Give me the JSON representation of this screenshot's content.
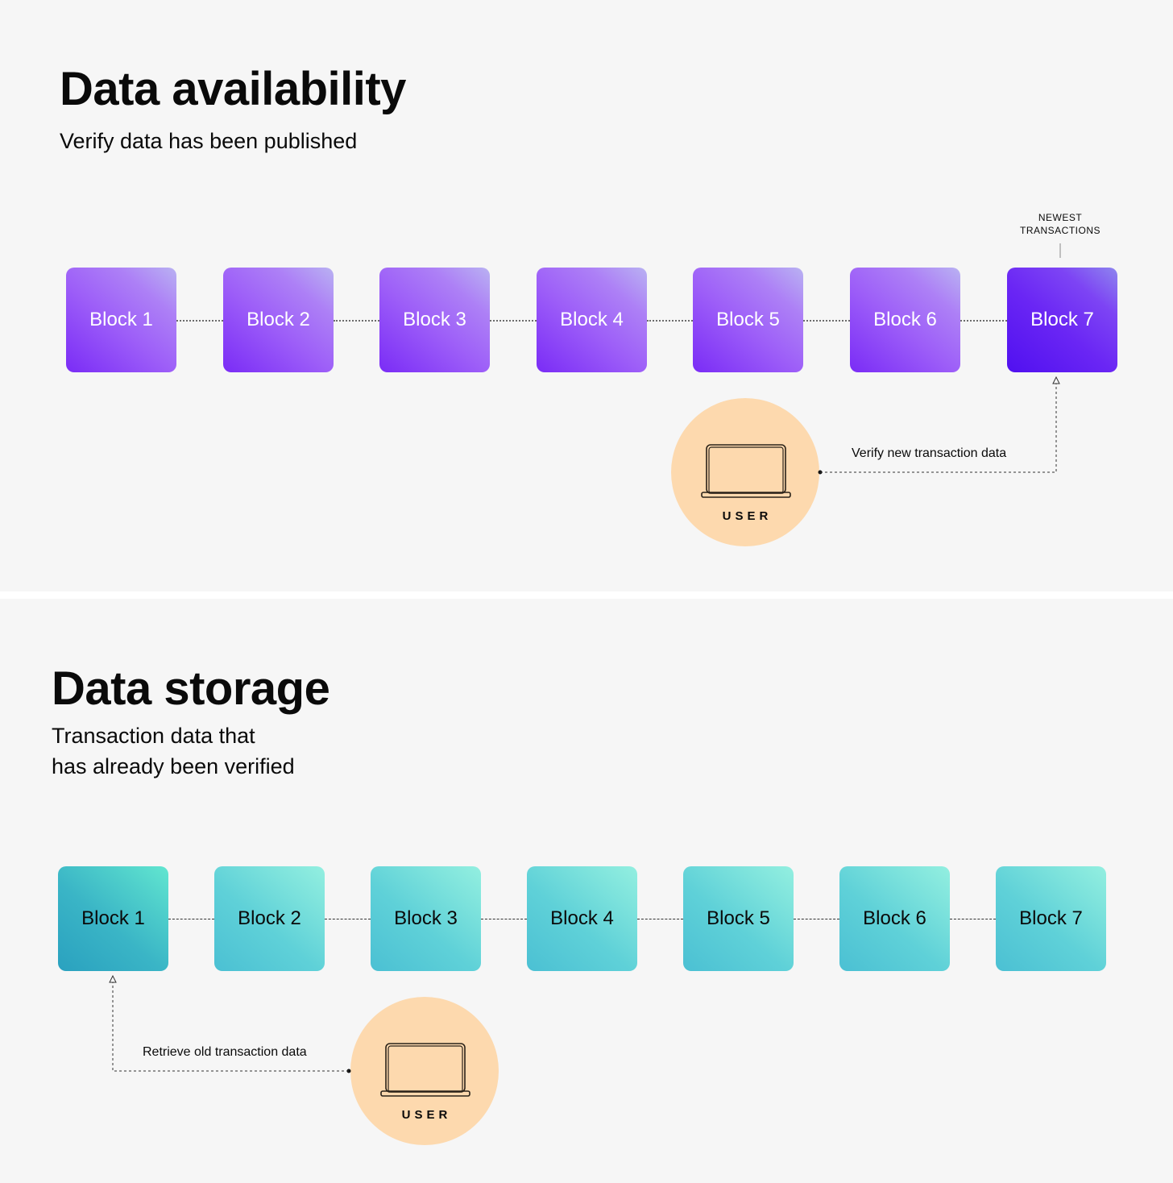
{
  "availability": {
    "title": "Data availability",
    "subtitle": "Verify data has been published",
    "blocks": [
      "Block 1",
      "Block 2",
      "Block 3",
      "Block 4",
      "Block 5",
      "Block 6",
      "Block 7"
    ],
    "newest_label": "NEWEST\nTRANSACTIONS",
    "user_label": "USER",
    "edge_label": "Verify new transaction data",
    "colors": {
      "block": "#9d5ef8",
      "newest_block": "#6a26f4",
      "user": "#fdd9ae"
    }
  },
  "storage": {
    "title": "Data storage",
    "subtitle": "Transaction data that\nhas already been verified",
    "blocks": [
      "Block 1",
      "Block 2",
      "Block 3",
      "Block 4",
      "Block 5",
      "Block 6",
      "Block 7"
    ],
    "user_label": "USER",
    "edge_label": "Retrieve old transaction data",
    "colors": {
      "block": "#5fd1d8",
      "target_block": "#3ab5c6",
      "user": "#fdd9ae"
    }
  }
}
